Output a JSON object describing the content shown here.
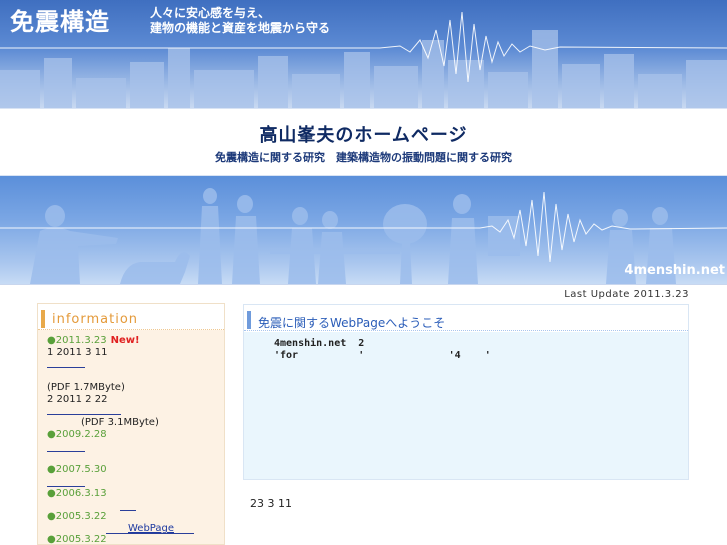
{
  "header": {
    "logo": "免震構造",
    "slogan_line1": "人々に安心感を与え、",
    "slogan_line2": "建物の機能と資産を地震から守る"
  },
  "title": {
    "main": "高山峯夫のホームページ",
    "subtitle": "免震構造に関する研究　建築構造物の振動問題に関する研究"
  },
  "banner": {
    "site_mark": "4menshin.net"
  },
  "update": {
    "text": "Last Update 2011.3.23"
  },
  "sidebar": {
    "heading": "information",
    "items": [
      {
        "date": "2011.3.23",
        "new_flag": "New!"
      },
      {
        "text": "1 2011 3 11"
      },
      {
        "text": "(PDF     1.7MByte)"
      },
      {
        "text": "2 2011 2 22"
      },
      {
        "text": "(PDF     3.1MByte)"
      },
      {
        "date": "2009.2.28"
      },
      {
        "date": "2007.5.30"
      },
      {
        "date": "2006.3.13"
      },
      {
        "date": "2005.3.22"
      },
      {
        "text": "WebPage"
      },
      {
        "date": "2005.3.22"
      }
    ]
  },
  "main": {
    "heading": "免震に関するWebPageへようこそ",
    "line1": "4menshin.net  2",
    "line2": "'for          '              '4    '",
    "note": "23 3 11"
  },
  "colors": {
    "sky_blue": "#5d8bd4",
    "accent_orange": "#e49a3a",
    "date_green": "#59a03a",
    "new_red": "#e02020",
    "panel_bg": "#eaf6fd",
    "sidebar_bg": "#fdf2e4"
  }
}
